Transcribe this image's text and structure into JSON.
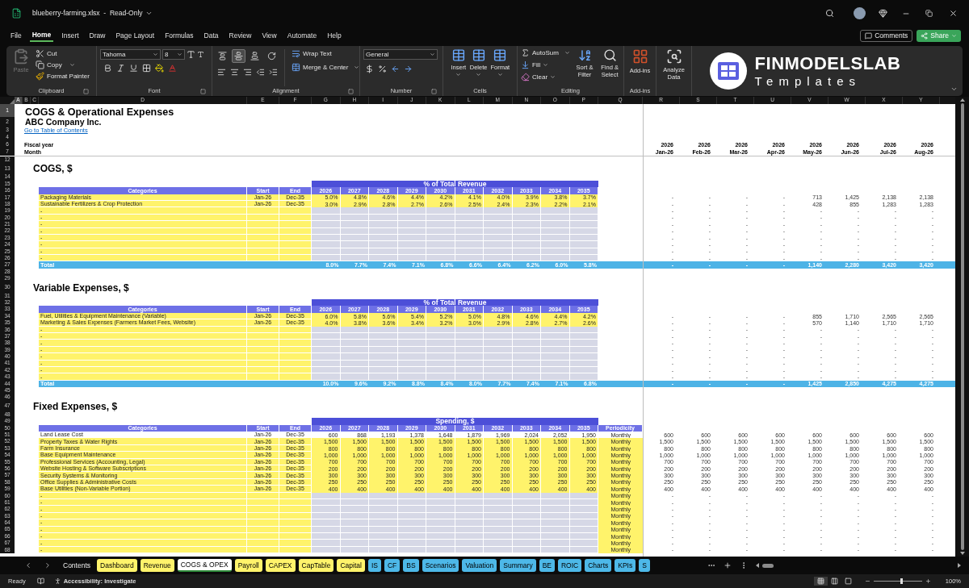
{
  "window": {
    "title": "blueberry-farming.xlsx  -  Read-Only"
  },
  "menu": [
    {
      "label": "File",
      "selected": false
    },
    {
      "label": "Home",
      "selected": true
    },
    {
      "label": "Insert",
      "selected": false
    },
    {
      "label": "Draw",
      "selected": false
    },
    {
      "label": "Page Layout",
      "selected": false
    },
    {
      "label": "Formulas",
      "selected": false
    },
    {
      "label": "Data",
      "selected": false
    },
    {
      "label": "Review",
      "selected": false
    },
    {
      "label": "View",
      "selected": false
    },
    {
      "label": "Automate",
      "selected": false
    },
    {
      "label": "Help",
      "selected": false
    }
  ],
  "actions": {
    "comments": "Comments",
    "share": "Share"
  },
  "ribbon": {
    "clipboard": {
      "paste": {
        "label": "Paste",
        "disabled": true
      },
      "cut": "Cut",
      "copy": "Copy",
      "format_painter": "Format Painter",
      "label": "Clipboard"
    },
    "font": {
      "name": "Tahoma",
      "size": "8",
      "label": "Font"
    },
    "alignment": {
      "vertical": [
        {
          "selected": false
        },
        {
          "selected": true
        },
        {
          "selected": false
        }
      ],
      "wrap_text": "Wrap Text",
      "merge": "Merge & Center",
      "label": "Alignment"
    },
    "number": {
      "format": "General",
      "label": "Number"
    },
    "cells": {
      "buttons": [
        "Insert",
        "Delete",
        "Format"
      ],
      "label": "Cells"
    },
    "editing": {
      "autosum": "AutoSum",
      "fill": "Fill",
      "clear": "Clear",
      "sort": "Sort & Filter",
      "find": "Find & Select",
      "label": "Editing"
    },
    "addins": {
      "button": "Add-ins",
      "label": "Add-ins"
    },
    "analyze": "Analyze Data"
  },
  "logo": {
    "name": "FINMODELSLAB",
    "tagline": "Templates"
  },
  "columns": [
    {
      "label": "A",
      "selected": true
    },
    {
      "label": "B",
      "selected": false
    },
    {
      "label": "C",
      "selected": false
    },
    {
      "label": "D",
      "selected": false
    },
    {
      "label": "E",
      "selected": false
    },
    {
      "label": "F",
      "selected": false
    },
    {
      "label": "G",
      "selected": false
    },
    {
      "label": "H",
      "selected": false
    },
    {
      "label": "I",
      "selected": false
    },
    {
      "label": "J",
      "selected": false
    },
    {
      "label": "K",
      "selected": false
    },
    {
      "label": "L",
      "selected": false
    },
    {
      "label": "M",
      "selected": false
    },
    {
      "label": "N",
      "selected": false
    },
    {
      "label": "O",
      "selected": false
    },
    {
      "label": "P",
      "selected": false
    },
    {
      "label": "Q",
      "selected": false
    },
    {
      "label": "R",
      "selected": false
    },
    {
      "label": "S",
      "selected": false
    },
    {
      "label": "T",
      "selected": false
    },
    {
      "label": "U",
      "selected": false
    },
    {
      "label": "V",
      "selected": false
    },
    {
      "label": "W",
      "selected": false
    },
    {
      "label": "X",
      "selected": false
    },
    {
      "label": "Y",
      "selected": false
    }
  ],
  "sheet": {
    "top_rows": [
      {
        "num": "1",
        "kind": "title",
        "text": "COGS & Operational Expenses",
        "selected": true
      },
      {
        "num": "2",
        "kind": "company",
        "text": "ABC Company Inc.",
        "selected": false
      },
      {
        "num": "3",
        "kind": "link",
        "text": "Go to Table of Contents",
        "selected": false
      },
      {
        "num": "4",
        "kind": "blank",
        "selected": false
      },
      {
        "num": "6",
        "kind": "label",
        "label": "Fiscal year",
        "monthly": [
          "2026",
          "2026",
          "2026",
          "2026",
          "2026",
          "2026",
          "2026",
          "2026"
        ],
        "selected": false
      },
      {
        "num": "7",
        "kind": "label",
        "label": "Month",
        "monthly": [
          "Jan-26",
          "Feb-26",
          "Mar-26",
          "Apr-26",
          "May-26",
          "Jun-26",
          "Jul-26",
          "Aug-26"
        ],
        "selected": false
      }
    ],
    "rows": [
      {
        "num": "12",
        "kind": "blank",
        "selected": false
      },
      {
        "num": "13",
        "kind": "heading",
        "text": "COGS, $",
        "selected": false
      },
      {
        "num": "14",
        "kind": "blank",
        "selected": false
      },
      {
        "num": "15",
        "kind": "band",
        "text": "% of Total Revenue",
        "selected": false
      },
      {
        "num": "16",
        "kind": "header",
        "columns": [
          "Categories",
          "Start",
          "End",
          "2026",
          "2027",
          "2028",
          "2029",
          "2030",
          "2031",
          "2032",
          "2033",
          "2034",
          "2035"
        ],
        "selected": false
      },
      {
        "num": "17",
        "kind": "data",
        "input": true,
        "category": "Packaging Materials",
        "start": "Jan-26",
        "end": "Dec-35",
        "values": [
          "5.0%",
          "4.8%",
          "4.6%",
          "4.4%",
          "4.2%",
          "4.1%",
          "4.0%",
          "3.9%",
          "3.8%",
          "3.7%"
        ],
        "monthly": [
          "-",
          "-",
          "-",
          "-",
          "713",
          "1,425",
          "2,138",
          "2,138"
        ],
        "selected": false
      },
      {
        "num": "18",
        "kind": "data",
        "input": true,
        "category": "Sustainable Fertilizers & Crop Protection",
        "start": "Jan-26",
        "end": "Dec-35",
        "values": [
          "3.0%",
          "2.9%",
          "2.8%",
          "2.7%",
          "2.6%",
          "2.5%",
          "2.4%",
          "2.3%",
          "2.2%",
          "2.1%"
        ],
        "monthly": [
          "-",
          "-",
          "-",
          "-",
          "428",
          "855",
          "1,283",
          "1,283"
        ],
        "selected": false
      },
      {
        "num": "19",
        "kind": "data",
        "input": true,
        "category": "-",
        "monthly": [
          "-",
          "-",
          "-",
          "-",
          "-",
          "-",
          "-",
          "-"
        ],
        "selected": false
      },
      {
        "num": "20",
        "kind": "data",
        "input": true,
        "category": "-",
        "monthly": [
          "-",
          "-",
          "-",
          "-",
          "-",
          "-",
          "-",
          "-"
        ],
        "selected": false
      },
      {
        "num": "21",
        "kind": "data",
        "input": true,
        "category": "-",
        "monthly": [
          "-",
          "-",
          "-",
          "-",
          "-",
          "-",
          "-",
          "-"
        ],
        "selected": false
      },
      {
        "num": "22",
        "kind": "data",
        "input": true,
        "category": "-",
        "monthly": [
          "-",
          "-",
          "-",
          "-",
          "-",
          "-",
          "-",
          "-"
        ],
        "selected": false
      },
      {
        "num": "23",
        "kind": "data",
        "input": true,
        "category": "-",
        "monthly": [
          "-",
          "-",
          "-",
          "-",
          "-",
          "-",
          "-",
          "-"
        ],
        "selected": false
      },
      {
        "num": "24",
        "kind": "data",
        "input": true,
        "category": "-",
        "monthly": [
          "-",
          "-",
          "-",
          "-",
          "-",
          "-",
          "-",
          "-"
        ],
        "selected": false
      },
      {
        "num": "25",
        "kind": "data",
        "input": true,
        "category": "-",
        "monthly": [
          "-",
          "-",
          "-",
          "-",
          "-",
          "-",
          "-",
          "-"
        ],
        "selected": false
      },
      {
        "num": "26",
        "kind": "data",
        "input": true,
        "category": "-",
        "monthly": [
          "-",
          "-",
          "-",
          "-",
          "-",
          "-",
          "-",
          "-"
        ],
        "selected": false
      },
      {
        "num": "27",
        "kind": "total",
        "label": "Total",
        "values": [
          "8.0%",
          "7.7%",
          "7.4%",
          "7.1%",
          "6.8%",
          "6.6%",
          "6.4%",
          "6.2%",
          "6.0%",
          "5.8%"
        ],
        "monthly": [
          "-",
          "-",
          "-",
          "-",
          "1,140",
          "2,280",
          "3,420",
          "3,420"
        ],
        "selected": false
      },
      {
        "num": "28",
        "kind": "blank",
        "selected": false
      },
      {
        "num": "29",
        "kind": "blank",
        "selected": false
      },
      {
        "num": "30",
        "kind": "heading",
        "text": "Variable Expenses, $",
        "selected": false
      },
      {
        "num": "31",
        "kind": "blank",
        "selected": false
      },
      {
        "num": "32",
        "kind": "band",
        "text": "% of Total Revenue",
        "selected": false
      },
      {
        "num": "33",
        "kind": "header",
        "columns": [
          "Categories",
          "Start",
          "End",
          "2026",
          "2027",
          "2028",
          "2029",
          "2030",
          "2031",
          "2032",
          "2033",
          "2034",
          "2035"
        ],
        "selected": false
      },
      {
        "num": "34",
        "kind": "data",
        "input": true,
        "category": "Fuel, Utilities & Equipment Maintenance (Variable)",
        "start": "Jan-26",
        "end": "Dec-35",
        "values": [
          "6.0%",
          "5.8%",
          "5.6%",
          "5.4%",
          "5.2%",
          "5.0%",
          "4.8%",
          "4.6%",
          "4.4%",
          "4.2%"
        ],
        "monthly": [
          "-",
          "-",
          "-",
          "-",
          "855",
          "1,710",
          "2,565",
          "2,565"
        ],
        "selected": false
      },
      {
        "num": "35",
        "kind": "data",
        "input": true,
        "category": "Marketing & Sales Expenses (Farmers Market Fees, Website)",
        "start": "Jan-26",
        "end": "Dec-35",
        "values": [
          "4.0%",
          "3.8%",
          "3.6%",
          "3.4%",
          "3.2%",
          "3.0%",
          "2.9%",
          "2.8%",
          "2.7%",
          "2.6%"
        ],
        "monthly": [
          "-",
          "-",
          "-",
          "-",
          "570",
          "1,140",
          "1,710",
          "1,710"
        ],
        "selected": false
      },
      {
        "num": "36",
        "kind": "data",
        "input": true,
        "category": "-",
        "monthly": [
          "-",
          "-",
          "-",
          "-",
          "-",
          "-",
          "-",
          "-"
        ],
        "selected": false
      },
      {
        "num": "37",
        "kind": "data",
        "input": true,
        "category": "-",
        "monthly": [
          "-",
          "-",
          "-",
          "-",
          "-",
          "-",
          "-",
          "-"
        ],
        "selected": false
      },
      {
        "num": "38",
        "kind": "data",
        "input": true,
        "category": "-",
        "monthly": [
          "-",
          "-",
          "-",
          "-",
          "-",
          "-",
          "-",
          "-"
        ],
        "selected": false
      },
      {
        "num": "39",
        "kind": "data",
        "input": true,
        "category": "-",
        "monthly": [
          "-",
          "-",
          "-",
          "-",
          "-",
          "-",
          "-",
          "-"
        ],
        "selected": false
      },
      {
        "num": "40",
        "kind": "data",
        "input": true,
        "category": "-",
        "monthly": [
          "-",
          "-",
          "-",
          "-",
          "-",
          "-",
          "-",
          "-"
        ],
        "selected": false
      },
      {
        "num": "41",
        "kind": "data",
        "input": true,
        "category": "-",
        "monthly": [
          "-",
          "-",
          "-",
          "-",
          "-",
          "-",
          "-",
          "-"
        ],
        "selected": false
      },
      {
        "num": "42",
        "kind": "data",
        "input": true,
        "category": "-",
        "monthly": [
          "-",
          "-",
          "-",
          "-",
          "-",
          "-",
          "-",
          "-"
        ],
        "selected": false
      },
      {
        "num": "43",
        "kind": "data",
        "input": true,
        "category": "-",
        "monthly": [
          "-",
          "-",
          "-",
          "-",
          "-",
          "-",
          "-",
          "-"
        ],
        "selected": false
      },
      {
        "num": "44",
        "kind": "total",
        "label": "Total",
        "values": [
          "10.0%",
          "9.6%",
          "9.2%",
          "8.8%",
          "8.4%",
          "8.0%",
          "7.7%",
          "7.4%",
          "7.1%",
          "6.8%"
        ],
        "monthly": [
          "-",
          "-",
          "-",
          "-",
          "1,425",
          "2,850",
          "4,275",
          "4,275"
        ],
        "selected": false
      },
      {
        "num": "45",
        "kind": "blank",
        "selected": false
      },
      {
        "num": "46",
        "kind": "blank",
        "selected": false
      },
      {
        "num": "47",
        "kind": "heading",
        "text": "Fixed Expenses, $",
        "selected": false
      },
      {
        "num": "48",
        "kind": "blank",
        "selected": false
      },
      {
        "num": "49",
        "kind": "band",
        "text": "Spending, $",
        "selected": false
      },
      {
        "num": "50",
        "kind": "header",
        "columns": [
          "Categories",
          "Start",
          "End",
          "2026",
          "2027",
          "2028",
          "2029",
          "2030",
          "2031",
          "2032",
          "2033",
          "2034",
          "2035",
          "Periodicity"
        ],
        "selected": false
      },
      {
        "num": "51",
        "kind": "data",
        "input": false,
        "category": "Land Lease Cost",
        "start": "Jan-26",
        "end": "Dec-35",
        "values": [
          "600",
          "868",
          "1,193",
          "1,378",
          "1,648",
          "1,879",
          "1,969",
          "2,024",
          "2,052",
          "1,950"
        ],
        "periodicity": "Monthly",
        "monthly": [
          "600",
          "600",
          "600",
          "600",
          "600",
          "600",
          "600",
          "600"
        ],
        "selected": false
      },
      {
        "num": "52",
        "kind": "data",
        "input": true,
        "category": "Property Taxes & Water Rights",
        "start": "Jan-26",
        "end": "Dec-35",
        "values": [
          "1,500",
          "1,500",
          "1,500",
          "1,500",
          "1,500",
          "1,500",
          "1,500",
          "1,500",
          "1,500",
          "1,500"
        ],
        "periodicity": "Monthly",
        "monthly": [
          "1,500",
          "1,500",
          "1,500",
          "1,500",
          "1,500",
          "1,500",
          "1,500",
          "1,500"
        ],
        "selected": false
      },
      {
        "num": "53",
        "kind": "data",
        "input": true,
        "category": "Farm Insurance",
        "start": "Jan-26",
        "end": "Dec-35",
        "values": [
          "800",
          "800",
          "800",
          "800",
          "800",
          "800",
          "800",
          "800",
          "800",
          "800"
        ],
        "periodicity": "Monthly",
        "monthly": [
          "800",
          "800",
          "800",
          "800",
          "800",
          "800",
          "800",
          "800"
        ],
        "selected": false
      },
      {
        "num": "54",
        "kind": "data",
        "input": true,
        "category": "Base Equipment Maintenance",
        "start": "Jan-26",
        "end": "Dec-35",
        "values": [
          "1,000",
          "1,000",
          "1,000",
          "1,000",
          "1,000",
          "1,000",
          "1,000",
          "1,000",
          "1,000",
          "1,000"
        ],
        "periodicity": "Monthly",
        "monthly": [
          "1,000",
          "1,000",
          "1,000",
          "1,000",
          "1,000",
          "1,000",
          "1,000",
          "1,000"
        ],
        "selected": false
      },
      {
        "num": "55",
        "kind": "data",
        "input": true,
        "category": "Professional Services (Accounting, Legal)",
        "start": "Jan-26",
        "end": "Dec-35",
        "values": [
          "700",
          "700",
          "700",
          "700",
          "700",
          "700",
          "700",
          "700",
          "700",
          "700"
        ],
        "periodicity": "Monthly",
        "monthly": [
          "700",
          "700",
          "700",
          "700",
          "700",
          "700",
          "700",
          "700"
        ],
        "selected": false
      },
      {
        "num": "56",
        "kind": "data",
        "input": true,
        "category": "Website Hosting & Software Subscriptions",
        "start": "Jan-26",
        "end": "Dec-35",
        "values": [
          "200",
          "200",
          "200",
          "200",
          "200",
          "200",
          "200",
          "200",
          "200",
          "200"
        ],
        "periodicity": "Monthly",
        "monthly": [
          "200",
          "200",
          "200",
          "200",
          "200",
          "200",
          "200",
          "200"
        ],
        "selected": false
      },
      {
        "num": "57",
        "kind": "data",
        "input": true,
        "category": "Security Systems & Monitoring",
        "start": "Jan-26",
        "end": "Dec-35",
        "values": [
          "300",
          "300",
          "300",
          "300",
          "300",
          "300",
          "300",
          "300",
          "300",
          "300"
        ],
        "periodicity": "Monthly",
        "monthly": [
          "300",
          "300",
          "300",
          "300",
          "300",
          "300",
          "300",
          "300"
        ],
        "selected": false
      },
      {
        "num": "58",
        "kind": "data",
        "input": true,
        "category": "Office Supplies & Administrative Costs",
        "start": "Jan-26",
        "end": "Dec-35",
        "values": [
          "250",
          "250",
          "250",
          "250",
          "250",
          "250",
          "250",
          "250",
          "250",
          "250"
        ],
        "periodicity": "Monthly",
        "monthly": [
          "250",
          "250",
          "250",
          "250",
          "250",
          "250",
          "250",
          "250"
        ],
        "selected": false
      },
      {
        "num": "59",
        "kind": "data",
        "input": true,
        "category": "Base Utilities (Non-Variable Portion)",
        "start": "Jan-26",
        "end": "Dec-35",
        "values": [
          "400",
          "400",
          "400",
          "400",
          "400",
          "400",
          "400",
          "400",
          "400",
          "400"
        ],
        "periodicity": "Monthly",
        "monthly": [
          "400",
          "400",
          "400",
          "400",
          "400",
          "400",
          "400",
          "400"
        ],
        "selected": false
      },
      {
        "num": "60",
        "kind": "data",
        "input": true,
        "category": "-",
        "periodicity": "Monthly",
        "monthly": [
          "-",
          "-",
          "-",
          "-",
          "-",
          "-",
          "-",
          "-"
        ],
        "selected": false
      },
      {
        "num": "61",
        "kind": "data",
        "input": true,
        "category": "-",
        "periodicity": "Monthly",
        "monthly": [
          "-",
          "-",
          "-",
          "-",
          "-",
          "-",
          "-",
          "-"
        ],
        "selected": false
      },
      {
        "num": "62",
        "kind": "data",
        "input": true,
        "category": "-",
        "periodicity": "Monthly",
        "monthly": [
          "-",
          "-",
          "-",
          "-",
          "-",
          "-",
          "-",
          "-"
        ],
        "selected": false
      },
      {
        "num": "63",
        "kind": "data",
        "input": true,
        "category": "-",
        "periodicity": "Monthly",
        "monthly": [
          "-",
          "-",
          "-",
          "-",
          "-",
          "-",
          "-",
          "-"
        ],
        "selected": false
      },
      {
        "num": "64",
        "kind": "data",
        "input": true,
        "category": "-",
        "periodicity": "Monthly",
        "monthly": [
          "-",
          "-",
          "-",
          "-",
          "-",
          "-",
          "-",
          "-"
        ],
        "selected": false
      },
      {
        "num": "65",
        "kind": "data",
        "input": true,
        "category": "-",
        "periodicity": "Monthly",
        "monthly": [
          "-",
          "-",
          "-",
          "-",
          "-",
          "-",
          "-",
          "-"
        ],
        "selected": false
      },
      {
        "num": "66",
        "kind": "data",
        "input": true,
        "category": "-",
        "periodicity": "Monthly",
        "monthly": [
          "-",
          "-",
          "-",
          "-",
          "-",
          "-",
          "-",
          "-"
        ],
        "selected": false
      },
      {
        "num": "67",
        "kind": "data",
        "input": true,
        "category": "-",
        "periodicity": "Monthly",
        "monthly": [
          "-",
          "-",
          "-",
          "-",
          "-",
          "-",
          "-",
          "-"
        ],
        "selected": false
      },
      {
        "num": "68",
        "kind": "data",
        "input": true,
        "category": "-",
        "periodicity": "Monthly",
        "monthly": [
          "-",
          "-",
          "-",
          "-",
          "-",
          "-",
          "-",
          "-"
        ],
        "selected": false
      }
    ]
  },
  "sheet_tabs": [
    {
      "label": "Contents",
      "selected": false
    },
    {
      "label": "Dashboard",
      "color": "#fff36b",
      "selected": false
    },
    {
      "label": "Revenue",
      "color": "#fff36b",
      "selected": false
    },
    {
      "label": "COGS & OPEX",
      "selected": true
    },
    {
      "label": "Payroll",
      "color": "#fff36b",
      "selected": false
    },
    {
      "label": "CAPEX",
      "color": "#fff36b",
      "selected": false
    },
    {
      "label": "CapTable",
      "color": "#fff36b",
      "selected": false
    },
    {
      "label": "Capital",
      "color": "#fff36b",
      "selected": false
    },
    {
      "label": "IS",
      "color": "#4db8e8",
      "selected": false
    },
    {
      "label": "CF",
      "color": "#4db8e8",
      "selected": false
    },
    {
      "label": "BS",
      "color": "#4db8e8",
      "selected": false
    },
    {
      "label": "Scenarios",
      "color": "#4db8e8",
      "selected": false
    },
    {
      "label": "Valuation",
      "color": "#4db8e8",
      "selected": false
    },
    {
      "label": "Summary",
      "color": "#4db8e8",
      "selected": false
    },
    {
      "label": "BE",
      "color": "#4db8e8",
      "selected": false
    },
    {
      "label": "ROIC",
      "color": "#4db8e8",
      "selected": false
    },
    {
      "label": "Charts",
      "color": "#4db8e8",
      "selected": false
    },
    {
      "label": "KPIs",
      "color": "#4db8e8",
      "selected": false
    },
    {
      "label": "S",
      "color": "#4db8e8",
      "selected": false
    }
  ],
  "status": {
    "ready": "Ready",
    "accessibility": "Accessibility: Investigate",
    "views": [
      {
        "selected": true
      },
      {
        "selected": false
      },
      {
        "selected": false
      }
    ],
    "zoom_slider": {
      "level": 0.55
    },
    "zoom": "100%"
  }
}
